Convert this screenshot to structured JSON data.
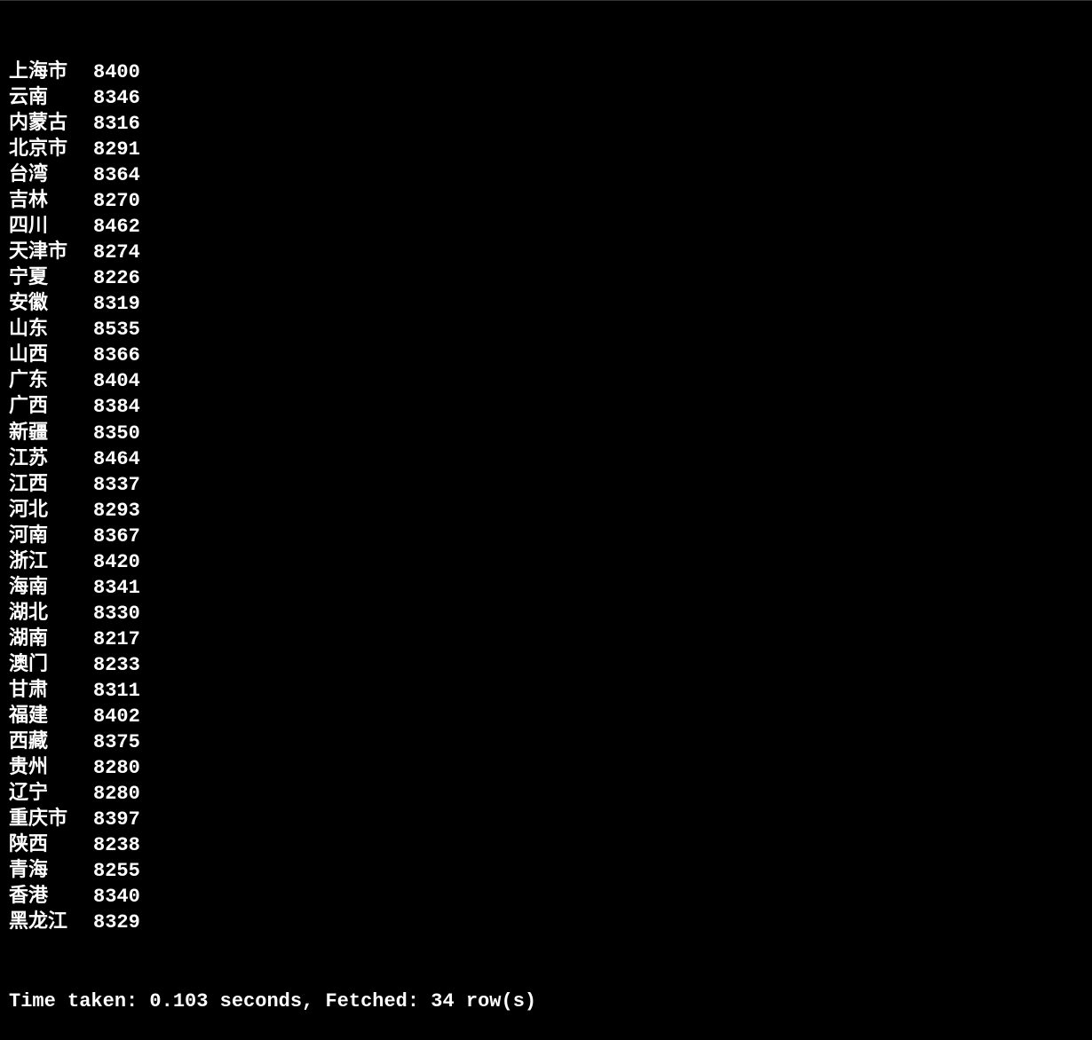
{
  "rows": [
    {
      "name": "上海市",
      "value": "8400"
    },
    {
      "name": "云南",
      "value": "8346"
    },
    {
      "name": "内蒙古",
      "value": "8316"
    },
    {
      "name": "北京市",
      "value": "8291"
    },
    {
      "name": "台湾",
      "value": "8364"
    },
    {
      "name": "吉林",
      "value": "8270"
    },
    {
      "name": "四川",
      "value": "8462"
    },
    {
      "name": "天津市",
      "value": "8274"
    },
    {
      "name": "宁夏",
      "value": "8226"
    },
    {
      "name": "安徽",
      "value": "8319"
    },
    {
      "name": "山东",
      "value": "8535"
    },
    {
      "name": "山西",
      "value": "8366"
    },
    {
      "name": "广东",
      "value": "8404"
    },
    {
      "name": "广西",
      "value": "8384"
    },
    {
      "name": "新疆",
      "value": "8350"
    },
    {
      "name": "江苏",
      "value": "8464"
    },
    {
      "name": "江西",
      "value": "8337"
    },
    {
      "name": "河北",
      "value": "8293"
    },
    {
      "name": "河南",
      "value": "8367"
    },
    {
      "name": "浙江",
      "value": "8420"
    },
    {
      "name": "海南",
      "value": "8341"
    },
    {
      "name": "湖北",
      "value": "8330"
    },
    {
      "name": "湖南",
      "value": "8217"
    },
    {
      "name": "澳门",
      "value": "8233"
    },
    {
      "name": "甘肃",
      "value": "8311"
    },
    {
      "name": "福建",
      "value": "8402"
    },
    {
      "name": "西藏",
      "value": "8375"
    },
    {
      "name": "贵州",
      "value": "8280"
    },
    {
      "name": "辽宁",
      "value": "8280"
    },
    {
      "name": "重庆市",
      "value": "8397"
    },
    {
      "name": "陕西",
      "value": "8238"
    },
    {
      "name": "青海",
      "value": "8255"
    },
    {
      "name": "香港",
      "value": "8340"
    },
    {
      "name": "黑龙江",
      "value": "8329"
    }
  ],
  "status": "Time taken: 0.103 seconds, Fetched: 34 row(s)"
}
